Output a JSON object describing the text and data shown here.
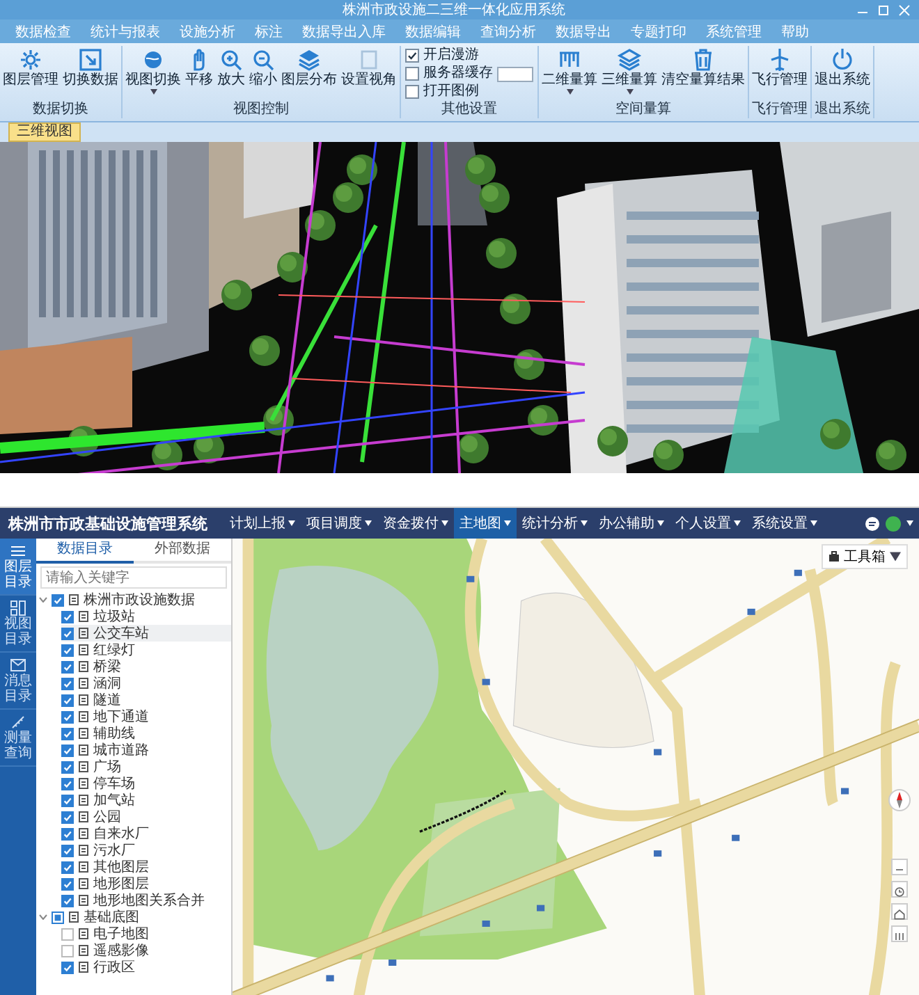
{
  "window": {
    "title": "株洲市政设施二三维一体化应用系统"
  },
  "ribbon": {
    "tabs": [
      "数据检查",
      "统计与报表",
      "设施分析",
      "标注",
      "数据导出入库",
      "数据编辑",
      "查询分析",
      "数据导出",
      "专题打印",
      "系统管理",
      "帮助"
    ],
    "groups": [
      {
        "label": "数据切换",
        "buttons": [
          {
            "label": "图层管理",
            "dropdown": false
          },
          {
            "label": "切换数据",
            "dropdown": false
          }
        ]
      },
      {
        "label": "视图控制",
        "buttons": [
          {
            "label": "视图切换",
            "dropdown": true
          },
          {
            "label": "平移",
            "dropdown": false
          },
          {
            "label": "放大",
            "dropdown": false
          },
          {
            "label": "缩小",
            "dropdown": false
          },
          {
            "label": "图层分布",
            "dropdown": false
          },
          {
            "label": "设置视角",
            "dropdown": false
          }
        ]
      },
      {
        "label": "其他设置",
        "checks": [
          {
            "label": "开启漫游",
            "checked": true,
            "field": false
          },
          {
            "label": "服务器缓存",
            "checked": false,
            "field": true
          },
          {
            "label": "打开图例",
            "checked": false,
            "field": false
          }
        ]
      },
      {
        "label": "空间量算",
        "buttons": [
          {
            "label": "二维量算",
            "dropdown": true
          },
          {
            "label": "三维量算",
            "dropdown": true
          },
          {
            "label": "清空量算结果",
            "dropdown": false
          }
        ]
      },
      {
        "label": "飞行管理",
        "buttons": [
          {
            "label": "飞行管理",
            "dropdown": false
          }
        ]
      },
      {
        "label": "退出系统",
        "buttons": [
          {
            "label": "退出系统",
            "dropdown": false
          }
        ]
      }
    ]
  },
  "doc_tab": {
    "label": "三维视图"
  },
  "app": {
    "title": "株洲市市政基础设施管理系统",
    "nav": [
      {
        "label": "计划上报",
        "selected": false
      },
      {
        "label": "项目调度",
        "selected": false
      },
      {
        "label": "资金拨付",
        "selected": false
      },
      {
        "label": "主地图",
        "selected": true
      },
      {
        "label": "统计分析",
        "selected": false
      },
      {
        "label": "办公辅助",
        "selected": false
      },
      {
        "label": "个人设置",
        "selected": false
      },
      {
        "label": "系统设置",
        "selected": false
      }
    ],
    "rail": [
      {
        "label": "图层目录",
        "selected": true
      },
      {
        "label": "视图目录",
        "selected": false
      },
      {
        "label": "消息目录",
        "selected": false
      },
      {
        "label": "测量查询",
        "selected": false
      }
    ],
    "panel_tabs": [
      {
        "label": "数据目录",
        "selected": true
      },
      {
        "label": "外部数据",
        "selected": false
      }
    ],
    "search": {
      "placeholder": "请输入关键字"
    },
    "tree": [
      {
        "label": "株洲市政设施数据",
        "checked": true,
        "indeterminate": false,
        "expanded": true,
        "selected": false,
        "children": [
          {
            "label": "垃圾站",
            "checked": true,
            "selected": false
          },
          {
            "label": "公交车站",
            "checked": true,
            "selected": true
          },
          {
            "label": "红绿灯",
            "checked": true,
            "selected": false
          },
          {
            "label": "桥梁",
            "checked": true,
            "selected": false
          },
          {
            "label": "涵洞",
            "checked": true,
            "selected": false
          },
          {
            "label": "隧道",
            "checked": true,
            "selected": false
          },
          {
            "label": "地下通道",
            "checked": true,
            "selected": false
          },
          {
            "label": "辅助线",
            "checked": true,
            "selected": false
          },
          {
            "label": "城市道路",
            "checked": true,
            "selected": false
          },
          {
            "label": "广场",
            "checked": true,
            "selected": false
          },
          {
            "label": "停车场",
            "checked": true,
            "selected": false
          },
          {
            "label": "加气站",
            "checked": true,
            "selected": false
          },
          {
            "label": "公园",
            "checked": true,
            "selected": false
          },
          {
            "label": "自来水厂",
            "checked": true,
            "selected": false
          },
          {
            "label": "污水厂",
            "checked": true,
            "selected": false
          },
          {
            "label": "其他图层",
            "checked": true,
            "selected": false
          },
          {
            "label": "地形图层",
            "checked": true,
            "selected": false
          },
          {
            "label": "地形地图关系合并",
            "checked": true,
            "selected": false
          }
        ]
      },
      {
        "label": "基础底图",
        "indeterminate": true,
        "expanded": true,
        "selected": false,
        "children": [
          {
            "label": "电子地图",
            "checked": false,
            "selected": false
          },
          {
            "label": "遥感影像",
            "checked": false,
            "selected": false
          },
          {
            "label": "行政区",
            "checked": true,
            "selected": false
          }
        ]
      }
    ],
    "map": {
      "toolbox": "工具箱"
    }
  }
}
